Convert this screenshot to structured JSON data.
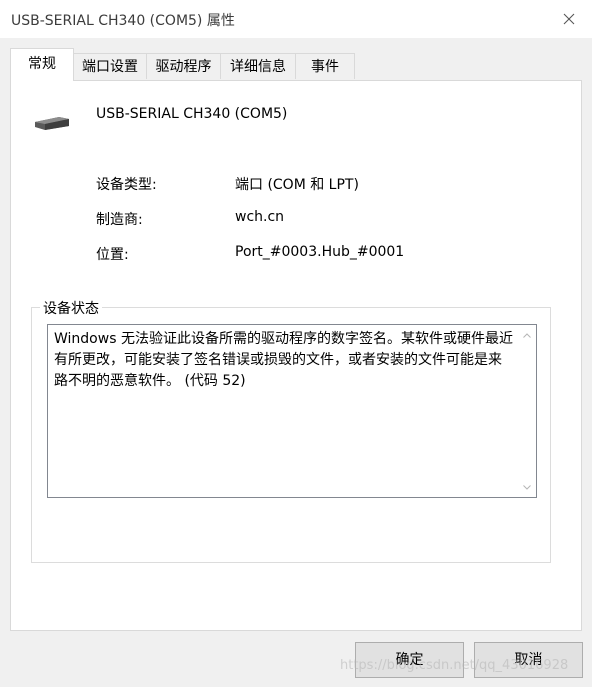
{
  "window": {
    "title": "USB-SERIAL CH340 (COM5) 属性"
  },
  "tabs": [
    {
      "label": "常规"
    },
    {
      "label": "端口设置"
    },
    {
      "label": "驱动程序"
    },
    {
      "label": "详细信息"
    },
    {
      "label": "事件"
    }
  ],
  "device": {
    "name": "USB-SERIAL CH340 (COM5)",
    "icon": "usb-serial-device-icon",
    "type_label": "设备类型:",
    "type_value": "端口 (COM 和 LPT)",
    "manufacturer_label": "制造商:",
    "manufacturer_value": "wch.cn",
    "location_label": "位置:",
    "location_value": "Port_#0003.Hub_#0001"
  },
  "status": {
    "legend": "设备状态",
    "text": "Windows 无法验证此设备所需的驱动程序的数字签名。某软件或硬件最近有所更改，可能安装了签名错误或损毁的文件，或者安装的文件可能是来路不明的恶意软件。 (代码 52)"
  },
  "buttons": {
    "ok": "确定",
    "cancel": "取消"
  },
  "watermark": "https://blog.csdn.net/qq_43016928"
}
